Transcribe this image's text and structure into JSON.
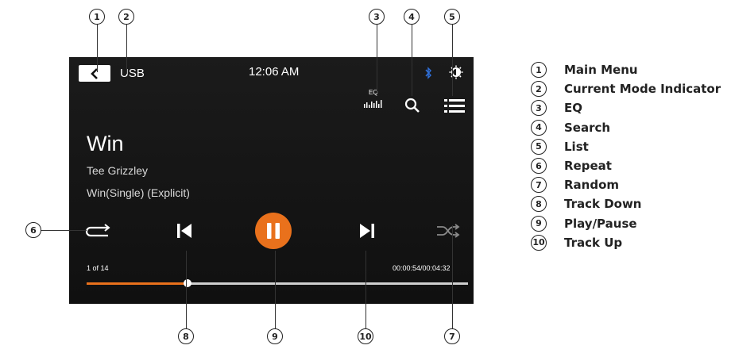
{
  "header": {
    "mode": "USB",
    "time": "12:06 AM",
    "eq_label": "EQ"
  },
  "track": {
    "title": "Win",
    "artist": "Tee Grizzley",
    "album": "Win(Single) (Explicit)",
    "position_text": "1 of 14",
    "time_text": "00:00:54/00:04:32",
    "progress_fraction": 0.264
  },
  "icons": {
    "back": "chevron-left-icon",
    "eq": "eq-icon",
    "search": "search-icon",
    "list": "list-icon",
    "bluetooth": "bluetooth-icon",
    "brightness": "brightness-icon",
    "repeat": "repeat-icon",
    "prev": "skip-previous-icon",
    "play_pause": "pause-icon",
    "next": "skip-next-icon",
    "shuffle": "shuffle-icon"
  },
  "colors": {
    "accent": "#e9711c",
    "bluetooth": "#2f6fd8",
    "screen_bg": "#141414"
  },
  "callouts": {
    "top": [
      "1",
      "2",
      "3",
      "4",
      "5"
    ],
    "left": [
      "6"
    ],
    "bottom": [
      "8",
      "9",
      "10",
      "7"
    ]
  },
  "legend": [
    {
      "num": "1",
      "label": "Main Menu"
    },
    {
      "num": "2",
      "label": "Current Mode Indicator"
    },
    {
      "num": "3",
      "label": "EQ"
    },
    {
      "num": "4",
      "label": "Search"
    },
    {
      "num": "5",
      "label": "List"
    },
    {
      "num": "6",
      "label": "Repeat"
    },
    {
      "num": "7",
      "label": "Random"
    },
    {
      "num": "8",
      "label": "Track Down"
    },
    {
      "num": "9",
      "label": "Play/Pause"
    },
    {
      "num": "10",
      "label": "Track Up"
    }
  ]
}
